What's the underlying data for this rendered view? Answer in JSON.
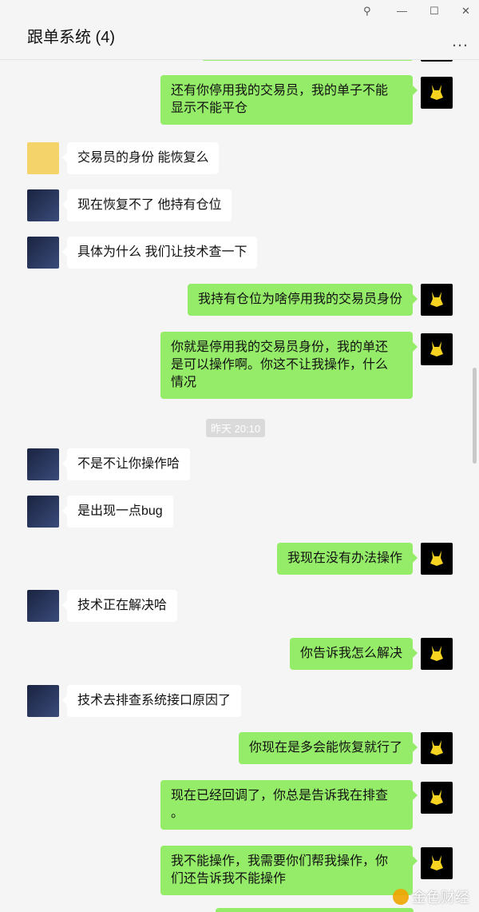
{
  "window": {
    "title": "跟单系统 (4)",
    "controls": {
      "pin": "⚲",
      "minimize": "—",
      "maximize": "☐",
      "close": "✕"
    },
    "more": "…"
  },
  "timestamp": "昨天 20:10",
  "messages": [
    {
      "from": "me",
      "text": "还有你停用我的交易员，我的单子不能\n显示不能平仓"
    },
    {
      "from": "user",
      "text": "交易员的身份 能恢复么"
    },
    {
      "from": "agent",
      "text": "现在恢复不了 他持有仓位"
    },
    {
      "from": "agent",
      "text": "具体为什么 我们让技术查一下"
    },
    {
      "from": "me",
      "text": "我持有仓位为啥停用我的交易员身份"
    },
    {
      "from": "me",
      "text": "你就是停用我的交易员身份，我的单还\n是可以操作啊。你这不让我操作，什么\n情况"
    },
    {
      "from": "agent",
      "text": "不是不让你操作哈"
    },
    {
      "from": "agent",
      "text": "是出现一点bug"
    },
    {
      "from": "me",
      "text": "我现在没有办法操作"
    },
    {
      "from": "agent",
      "text": "技术正在解决哈"
    },
    {
      "from": "me",
      "text": "你告诉我怎么解决"
    },
    {
      "from": "agent",
      "text": "技术去排查系统接口原因了"
    },
    {
      "from": "me",
      "text": "你现在是多会能恢复就行了"
    },
    {
      "from": "me",
      "text": "现在已经回调了，你总是告诉我在排查\n。"
    },
    {
      "from": "me",
      "text": "我不能操作，我需要你们帮我操作，你\n们还告诉我不能操作"
    }
  ],
  "watermark": "金色财经",
  "colors": {
    "me_bubble": "#95ec69",
    "other_bubble": "#ffffff",
    "background": "#f5f5f5"
  }
}
